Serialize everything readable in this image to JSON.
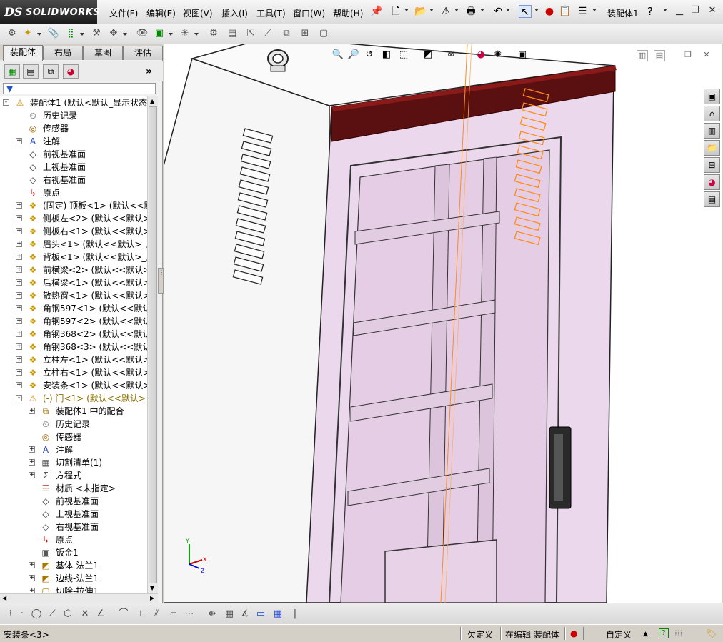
{
  "app": {
    "logo_ds": "DS",
    "logo_brand": "SOLIDWORKS",
    "document_title": "装配体1",
    "help_label": "?"
  },
  "menu": {
    "items": [
      "文件(F)",
      "编辑(E)",
      "视图(V)",
      "插入(I)",
      "工具(T)",
      "窗口(W)",
      "帮助(H)"
    ]
  },
  "panel": {
    "tabs": [
      {
        "label": "装配体",
        "active": true
      },
      {
        "label": "布局",
        "active": false
      },
      {
        "label": "草图",
        "active": false
      },
      {
        "label": "评估",
        "active": false
      }
    ],
    "chevron": "»"
  },
  "tree": {
    "rows": [
      {
        "indent": 0,
        "expander": "-",
        "icon": "assembly-warning",
        "label": "装配体1 (默认<默认_显示状态-"
      },
      {
        "indent": 1,
        "expander": "",
        "icon": "history",
        "label": "历史记录"
      },
      {
        "indent": 1,
        "expander": "",
        "icon": "sensor",
        "label": "传感器"
      },
      {
        "indent": 1,
        "expander": "+",
        "icon": "annotation",
        "label": "注解"
      },
      {
        "indent": 1,
        "expander": "",
        "icon": "plane",
        "label": "前视基准面"
      },
      {
        "indent": 1,
        "expander": "",
        "icon": "plane",
        "label": "上视基准面"
      },
      {
        "indent": 1,
        "expander": "",
        "icon": "plane",
        "label": "右视基准面"
      },
      {
        "indent": 1,
        "expander": "",
        "icon": "origin",
        "label": "原点"
      },
      {
        "indent": 1,
        "expander": "+",
        "icon": "part",
        "label": "(固定) 顶板<1> (默认<<默认>_"
      },
      {
        "indent": 1,
        "expander": "+",
        "icon": "part",
        "label": "侧板左<2> (默认<<默认>_显示"
      },
      {
        "indent": 1,
        "expander": "+",
        "icon": "part",
        "label": "侧板右<1> (默认<<默认>_显示"
      },
      {
        "indent": 1,
        "expander": "+",
        "icon": "part",
        "label": "眉头<1> (默认<<默认>_显示状"
      },
      {
        "indent": 1,
        "expander": "+",
        "icon": "part",
        "label": "背板<1> (默认<<默认>_显示状"
      },
      {
        "indent": 1,
        "expander": "+",
        "icon": "part",
        "label": "前横梁<2> (默认<<默认>_显示"
      },
      {
        "indent": 1,
        "expander": "+",
        "icon": "part",
        "label": "后横梁<1> (默认<<默认>_显示"
      },
      {
        "indent": 1,
        "expander": "+",
        "icon": "part",
        "label": "散热窗<1> (默认<<默认>_显示"
      },
      {
        "indent": 1,
        "expander": "+",
        "icon": "part",
        "label": "角钢597<1> (默认<<默认>_显"
      },
      {
        "indent": 1,
        "expander": "+",
        "icon": "part",
        "label": "角钢597<2> (默认<<默认>_显"
      },
      {
        "indent": 1,
        "expander": "+",
        "icon": "part",
        "label": "角钢368<2> (默认<<默认>_显"
      },
      {
        "indent": 1,
        "expander": "+",
        "icon": "part",
        "label": "角钢368<3> (默认<<默认>_显"
      },
      {
        "indent": 1,
        "expander": "+",
        "icon": "part",
        "label": "立柱左<1> (默认<<默认>_显示"
      },
      {
        "indent": 1,
        "expander": "+",
        "icon": "part",
        "label": "立柱右<1> (默认<<默认>_显示"
      },
      {
        "indent": 1,
        "expander": "+",
        "icon": "part",
        "label": "安装条<1> (默认<<默认>_显示"
      },
      {
        "indent": 1,
        "expander": "-",
        "icon": "part-warning",
        "label": "(-) 门<1> (默认<<默认>_显",
        "dim": true
      },
      {
        "indent": 2,
        "expander": "+",
        "icon": "mates",
        "label": "装配体1 中的配合"
      },
      {
        "indent": 2,
        "expander": "",
        "icon": "history",
        "label": "历史记录"
      },
      {
        "indent": 2,
        "expander": "",
        "icon": "sensor",
        "label": "传感器"
      },
      {
        "indent": 2,
        "expander": "+",
        "icon": "annotation",
        "label": "注解"
      },
      {
        "indent": 2,
        "expander": "+",
        "icon": "cutlist",
        "label": "切割清单(1)"
      },
      {
        "indent": 2,
        "expander": "+",
        "icon": "equation",
        "label": "方程式"
      },
      {
        "indent": 2,
        "expander": "",
        "icon": "material",
        "label": "材质 <未指定>"
      },
      {
        "indent": 2,
        "expander": "",
        "icon": "plane",
        "label": "前视基准面"
      },
      {
        "indent": 2,
        "expander": "",
        "icon": "plane",
        "label": "上视基准面"
      },
      {
        "indent": 2,
        "expander": "",
        "icon": "plane",
        "label": "右视基准面"
      },
      {
        "indent": 2,
        "expander": "",
        "icon": "origin",
        "label": "原点"
      },
      {
        "indent": 2,
        "expander": "",
        "icon": "sheetmetal",
        "label": "钣金1"
      },
      {
        "indent": 2,
        "expander": "+",
        "icon": "flange",
        "label": "基体-法兰1"
      },
      {
        "indent": 2,
        "expander": "+",
        "icon": "flange",
        "label": "边线-法兰1"
      },
      {
        "indent": 2,
        "expander": "+",
        "icon": "cut",
        "label": "切除-拉伸1"
      }
    ]
  },
  "triad": {
    "x": "X",
    "y": "Y",
    "z": "Z"
  },
  "status": {
    "selection": "安装条<3>",
    "definition": "欠定义",
    "editing": "在编辑 装配体",
    "units": "自定义"
  },
  "colors": {
    "header_bar": "#5a1010",
    "highlight_orange": "#ff8c1a",
    "door_fill": "#e8d4e8",
    "viewport_bg": "#ffffff"
  }
}
